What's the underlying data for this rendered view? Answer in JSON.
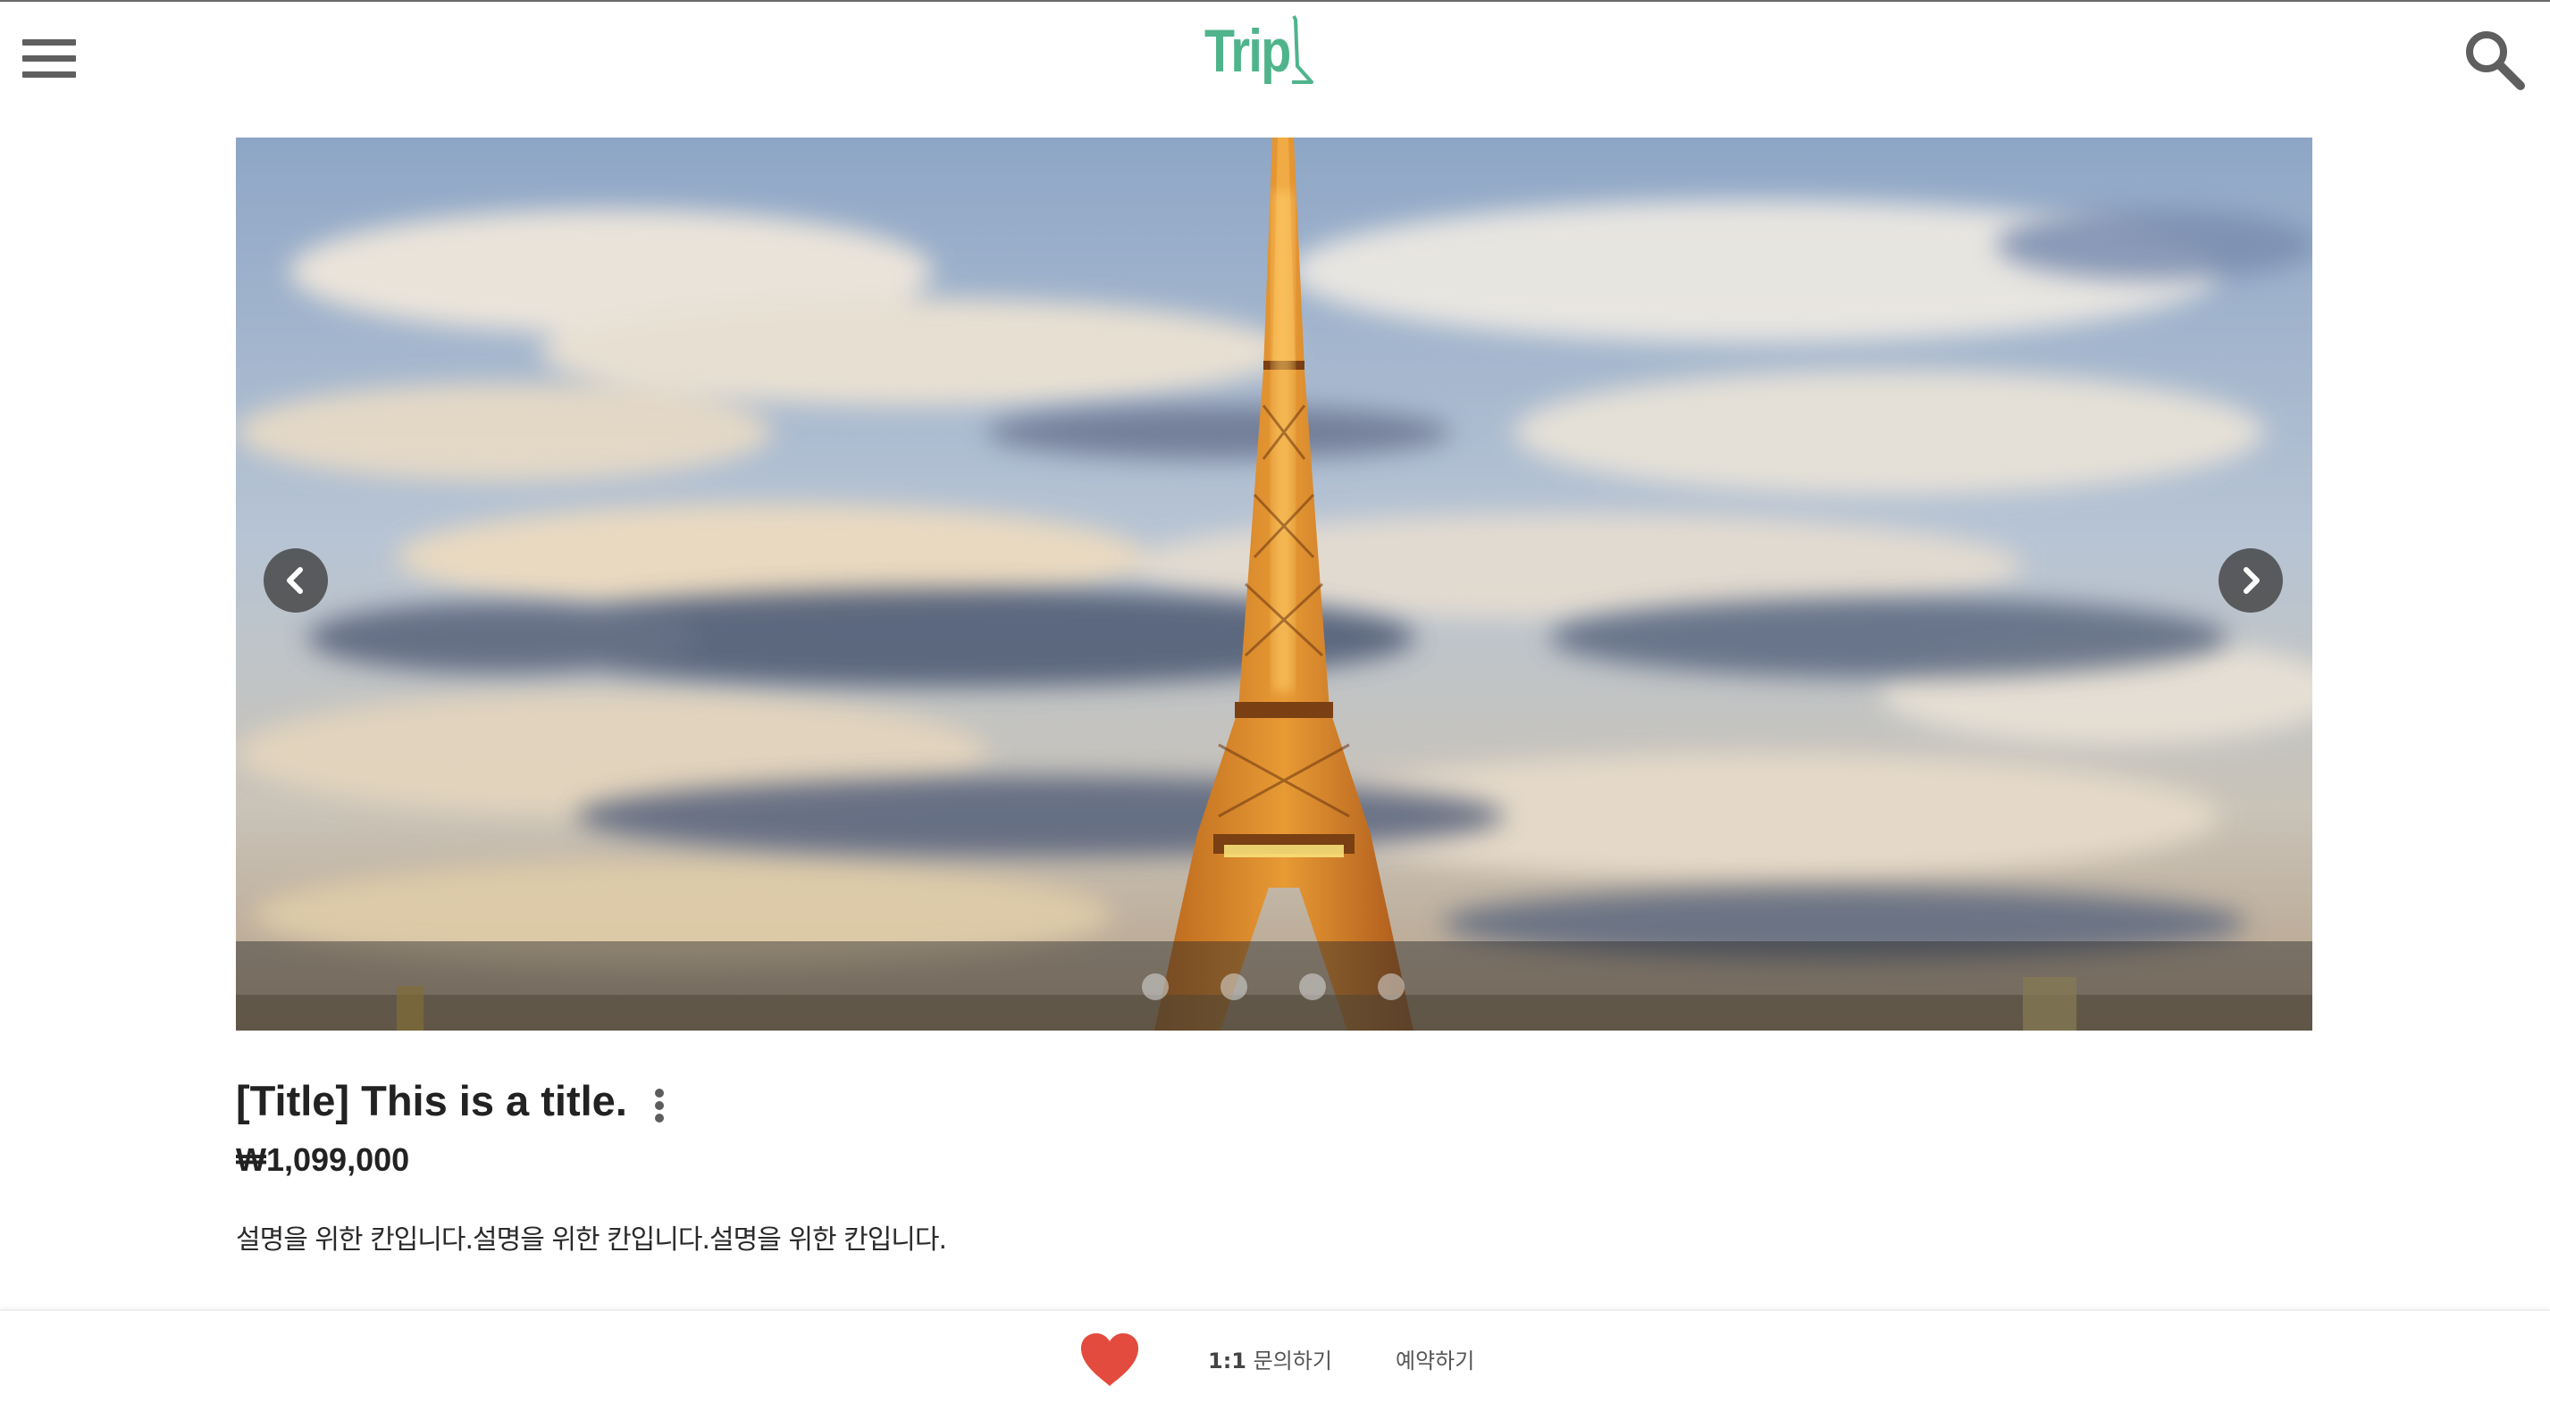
{
  "header": {
    "logo_text": "Trip",
    "menu_icon": "hamburger-menu-icon",
    "search_icon": "search-icon",
    "logo_color": "#4fb48c"
  },
  "carousel": {
    "image_subject": "Eiffel Tower under cloudy sky",
    "slide_count": 4,
    "prev_icon": "chevron-left-icon",
    "next_icon": "chevron-right-icon"
  },
  "product": {
    "title": "[Title] This is a title.",
    "more_icon": "more-vertical-icon",
    "price": "₩1,099,000",
    "description": "설명을 위한 칸입니다.설명을 위한 칸입니다.설명을 위한 칸입니다."
  },
  "bottom_bar": {
    "like_icon": "heart-icon",
    "like_color": "#e24b3d",
    "inquiry_prefix": "1:1",
    "inquiry_label": "문의하기",
    "reserve_label": "예약하기"
  }
}
